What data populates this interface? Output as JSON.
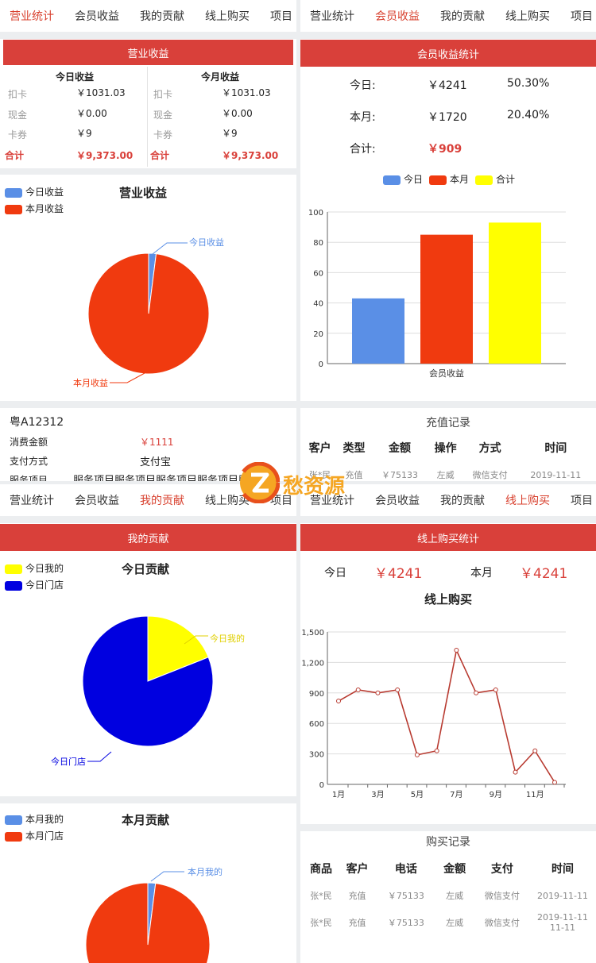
{
  "tabs": [
    "营业统计",
    "会员收益",
    "我的贡献",
    "线上购买",
    "项目"
  ],
  "q1": {
    "header": "营业收益",
    "cols": [
      {
        "title": "今日收益",
        "rows": [
          [
            "扣卡",
            "￥1031.03"
          ],
          [
            "现金",
            "￥0.00"
          ],
          [
            "卡券",
            "￥9"
          ]
        ],
        "total": [
          "合计",
          "￥9,373.00"
        ]
      },
      {
        "title": "今月收益",
        "rows": [
          [
            "扣卡",
            "￥1031.03"
          ],
          [
            "现金",
            "￥0.00"
          ],
          [
            "卡券",
            "￥9"
          ]
        ],
        "total": [
          "合计",
          "￥9,373.00"
        ]
      }
    ],
    "chart_title": "营业收益",
    "legend": [
      "今日收益",
      "本月收益"
    ],
    "labels": [
      "今日收益",
      "本月收益"
    ],
    "record": {
      "plate": "粤A12312",
      "rows": [
        [
          "消费金额",
          "￥1111"
        ],
        [
          "支付方式",
          "支付宝"
        ]
      ],
      "service_label": "服务项目",
      "service_value": "服务项目服务项目服务项目服务项目服务"
    }
  },
  "q2": {
    "header": "会员收益统计",
    "stats": [
      [
        "今日:",
        "￥4241",
        "50.30%"
      ],
      [
        "本月:",
        "￥1720",
        "20.40%"
      ]
    ],
    "total_label": "合计:",
    "total_value": "￥909",
    "legend": [
      "今日",
      "本月",
      "合计"
    ],
    "record_title": "充值记录",
    "headers": [
      "客户",
      "类型",
      "金额",
      "操作",
      "方式",
      "时间"
    ],
    "row": [
      "张*民",
      "充值",
      "￥75133",
      "左威",
      "微信支付",
      "2019-11-11"
    ]
  },
  "q3": {
    "header": "我的贡献",
    "today_title": "今日贡献",
    "today_legend": [
      "今日我的",
      "今日门店"
    ],
    "today_labels": [
      "今日我的",
      "今日门店"
    ],
    "month_title": "本月贡献",
    "month_legend": [
      "本月我的",
      "本月门店"
    ],
    "month_labels": [
      "本月我的"
    ]
  },
  "q4": {
    "header": "线上购买统计",
    "today_label": "今日",
    "today_value": "￥4241",
    "month_label": "本月",
    "month_value": "￥4241",
    "chart_title": "线上购买",
    "record_title": "购买记录",
    "headers": [
      "商品",
      "客户",
      "电话",
      "金额",
      "支付",
      "时间"
    ],
    "rows": [
      [
        "张*民",
        "充值",
        "￥75133",
        "左威",
        "微信支付",
        "2019-11-11"
      ],
      [
        "张*民",
        "充值",
        "￥75133",
        "左威",
        "微信支付",
        "2019-11-11 11-11"
      ]
    ]
  },
  "watermark": {
    "text": "愁资源"
  },
  "colors": {
    "red": "#d9403a",
    "blue": "#5a8fe6",
    "orange_red": "#f03a0f",
    "yellow": "#ffff00",
    "navy": "#0000e0",
    "line": "#b83a30"
  },
  "chart_data": [
    {
      "type": "pie",
      "series": [
        {
          "name": "今日收益",
          "value": 2
        },
        {
          "name": "本月收益",
          "value": 98
        }
      ]
    },
    {
      "type": "bar",
      "categories": [
        "会员收益"
      ],
      "series": [
        {
          "name": "今日",
          "values": [
            43
          ]
        },
        {
          "name": "本月",
          "values": [
            85
          ]
        },
        {
          "name": "合计",
          "values": [
            93
          ]
        }
      ],
      "xlabel": "会员收益",
      "ylim": [
        0,
        100
      ],
      "yticks": [
        0,
        20,
        40,
        60,
        80,
        100
      ],
      "grid": true
    },
    {
      "type": "pie",
      "series": [
        {
          "name": "今日我的",
          "value": 19
        },
        {
          "name": "今日门店",
          "value": 81
        }
      ]
    },
    {
      "type": "pie",
      "series": [
        {
          "name": "本月我的",
          "value": 2
        },
        {
          "name": "本月门店",
          "value": 98
        }
      ]
    },
    {
      "type": "line",
      "x": [
        "1月",
        "2月",
        "3月",
        "4月",
        "5月",
        "6月",
        "7月",
        "8月",
        "9月",
        "10月",
        "11月",
        "12月"
      ],
      "xticklabels": [
        "1月",
        "3月",
        "5月",
        "7月",
        "9月",
        "11月"
      ],
      "series": [
        {
          "values": [
            820,
            930,
            900,
            930,
            290,
            330,
            1320,
            900,
            930,
            120,
            330,
            20
          ]
        }
      ],
      "ylim": [
        0,
        1500
      ],
      "yticks": [
        "0",
        "300",
        "600",
        "900",
        "1,200",
        "1,500"
      ],
      "grid": true
    }
  ]
}
